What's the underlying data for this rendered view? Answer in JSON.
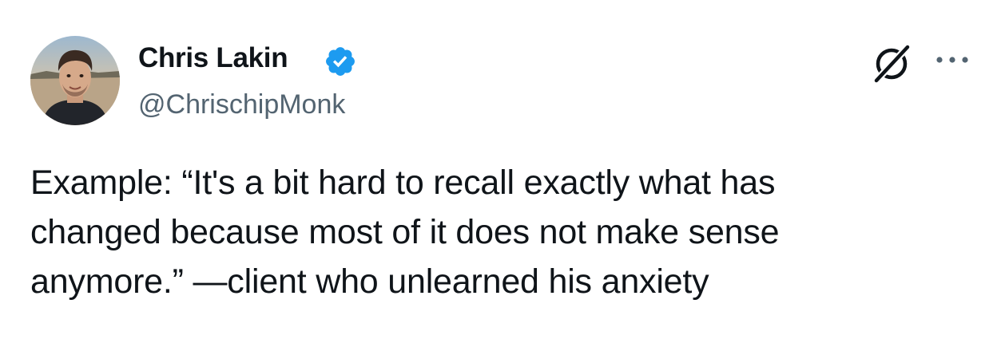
{
  "author": {
    "display_name": "Chris Lakin",
    "handle": "@ChrischipMonk",
    "verified": true
  },
  "tweet": {
    "lines": [
      "Example: “It's a bit hard to recall exactly what has",
      "changed because most of it does not make sense",
      "anymore.” —client who unlearned his anxiety"
    ]
  },
  "icons": {
    "avatar": "profile-photo",
    "verified": "verified-badge-icon",
    "grok": "grok-icon",
    "more": "more-options-icon"
  },
  "colors": {
    "text": "#0f1419",
    "secondary_text": "#536471",
    "verified_blue": "#1d9bf0"
  }
}
